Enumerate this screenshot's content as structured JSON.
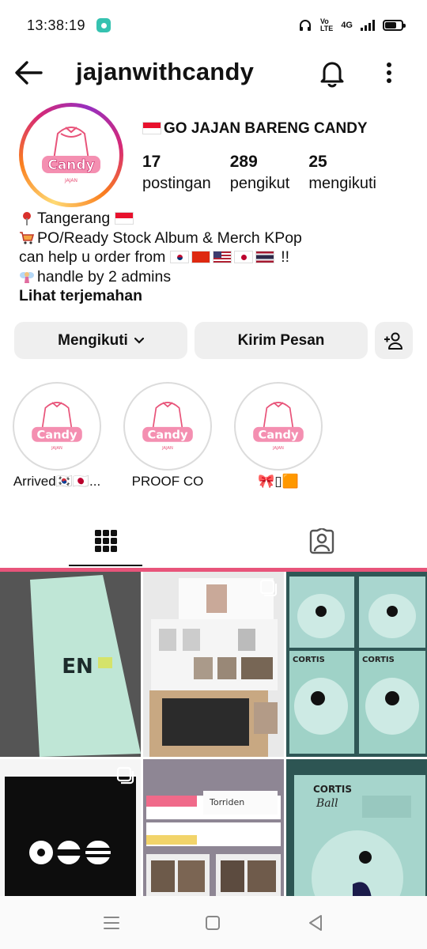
{
  "status_bar": {
    "time": "13:38:19",
    "network_top": "Vo",
    "network_bottom": "LTE",
    "signal_label": "4G"
  },
  "header": {
    "username": "jajanwithcandy"
  },
  "profile": {
    "full_name": "GO JAJAN BARENG CANDY",
    "stats": [
      {
        "value": "17",
        "label": "postingan"
      },
      {
        "value": "289",
        "label": "pengikut"
      },
      {
        "value": "25",
        "label": "mengikuti"
      }
    ],
    "bio": {
      "line1": "Tangerang",
      "line2": "PO/Ready Stock Album & Merch KPop",
      "line3_prefix": "can help u order from",
      "line3_suffix": "!!",
      "line4": "handle by 2 admins",
      "translate": "Lihat terjemahan"
    },
    "avatar_text": "Candy",
    "avatar_subtext": "JAJAN"
  },
  "buttons": {
    "follow": "Mengikuti",
    "message": "Kirim Pesan"
  },
  "highlights": [
    {
      "label": "Arrived🇰🇷🇯🇵..."
    },
    {
      "label": "PROOF CO"
    },
    {
      "label": "🎀▯🟧"
    }
  ],
  "grid": {
    "post1_text": "EN",
    "post3_text": "CORTIS",
    "post6_text": "CORTIS",
    "post6_sub": "Ball",
    "post5_text": "Torriden"
  },
  "colors": {
    "accent_pink": "#e8547a",
    "button_bg": "#efefef"
  }
}
